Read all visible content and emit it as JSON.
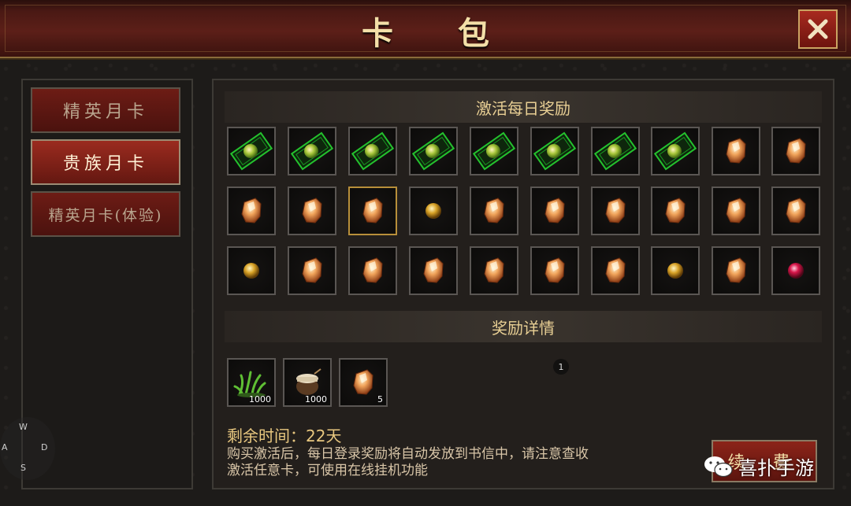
{
  "title": "卡 包",
  "tabs": [
    {
      "label": "精英月卡",
      "active": false
    },
    {
      "label": "贵族月卡",
      "active": true
    },
    {
      "label": "精英月卡(体验)",
      "active": false
    }
  ],
  "daily_rewards": {
    "header": "激活每日奖励",
    "rows": [
      [
        "green-ticket-icon",
        "green-ticket-icon",
        "green-ticket-icon",
        "green-ticket-icon",
        "green-ticket-icon",
        "green-ticket-icon",
        "green-ticket-icon",
        "green-ticket-icon",
        "amber-crystal-icon",
        "amber-crystal-icon"
      ],
      [
        "amber-crystal-icon",
        "amber-crystal-icon",
        "amber-crystal-icon",
        "gold-orb-icon",
        "amber-crystal-icon",
        "amber-crystal-icon",
        "amber-crystal-icon",
        "amber-crystal-icon",
        "amber-crystal-icon",
        "amber-crystal-icon"
      ],
      [
        "gold-orb-icon",
        "amber-crystal-icon",
        "amber-crystal-icon",
        "amber-crystal-icon",
        "amber-crystal-icon",
        "amber-crystal-icon",
        "amber-crystal-icon",
        "gold-orb-icon",
        "amber-crystal-icon",
        "red-orb-icon"
      ]
    ]
  },
  "reward_details": {
    "header": "奖励详情",
    "items": [
      {
        "icon": "grass-icon",
        "qty": "1000"
      },
      {
        "icon": "pouch-icon",
        "qty": "1000"
      },
      {
        "icon": "amber-crystal-icon",
        "qty": "5"
      }
    ],
    "badge": "1"
  },
  "remaining_time": "剩余时间：22天",
  "description_line1": "购买激活后，每日登录奖励将自动发放到书信中，请注意查收",
  "description_line2": "激活任意卡，可使用在线挂机功能",
  "renew_label": "续 费",
  "joystick": {
    "w": "W",
    "a": "A",
    "s": "S",
    "d": "D"
  },
  "watermark": "喜扑手游",
  "colors": {
    "accent_gold": "#e8cf94",
    "button_red": "#8c2419"
  }
}
